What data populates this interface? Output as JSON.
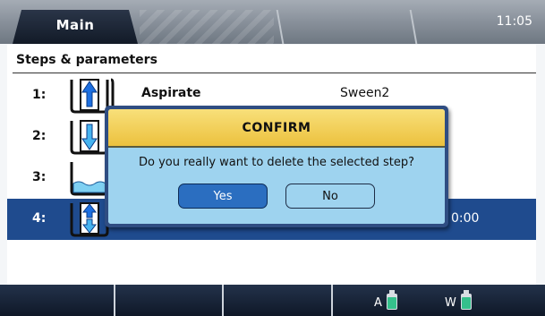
{
  "header": {
    "tabs": [
      {
        "label": "Main",
        "active": true
      },
      {
        "label": "",
        "active": false
      },
      {
        "label": "",
        "active": false
      }
    ],
    "clock": "11:05"
  },
  "section": {
    "title": "Steps & parameters"
  },
  "steps": [
    {
      "number": "1:",
      "name": "Aspirate",
      "param": "Sween2",
      "icon": "aspirate-icon",
      "selected": false
    },
    {
      "number": "2:",
      "name": "",
      "param": "",
      "icon": "dispense-icon",
      "selected": false
    },
    {
      "number": "3:",
      "name": "",
      "param": "",
      "icon": "soak-icon",
      "selected": false
    },
    {
      "number": "4:",
      "name": "",
      "param": "",
      "time": "0:00",
      "icon": "aspirate-dispense-icon",
      "selected": true
    }
  ],
  "bottom_bar": {
    "vessels": [
      {
        "label": "A",
        "icon": "bottle-icon",
        "color": "#35c08c"
      },
      {
        "label": "W",
        "icon": "bottle-icon",
        "color": "#35c08c"
      }
    ]
  },
  "dialog": {
    "title": "CONFIRM",
    "message": "Do you really want to delete the selected step?",
    "yes_label": "Yes",
    "no_label": "No"
  },
  "colors": {
    "selected_row": "#1f4b8e",
    "dialog_title_bg": "#ecc13e",
    "dialog_body_bg": "#9ed3ef",
    "yes_button": "#2b6ec0"
  }
}
